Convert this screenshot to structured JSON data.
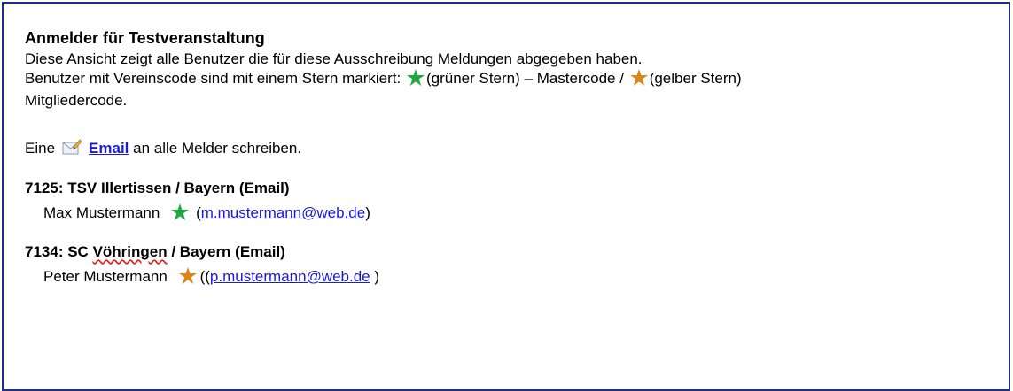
{
  "heading": "Anmelder für Testveranstaltung",
  "intro": {
    "line1": "Diese Ansicht zeigt alle Benutzer die für diese Ausschreibung Meldungen abgegeben haben.",
    "line2_a": "Benutzer mit Vereinscode sind mit einem Stern markiert:",
    "line2_b": "(grüner Stern) – Mastercode /",
    "line2_c": "(gelber Stern)",
    "line3": "Mitgliedercode."
  },
  "email_all": {
    "prefix": "Eine",
    "link": "Email",
    "suffix": "an alle Melder schreiben."
  },
  "clubs": [
    {
      "title": "7125: TSV Illertissen / Bayern (Email)",
      "member_name": "Max Mustermann",
      "open": "(",
      "email": "m.mustermann@web.de",
      "close": ")"
    },
    {
      "title_a": "7134: SC",
      "title_b": "Vöhringen",
      "title_c": "/ Bayern (Email)",
      "member_name": "Peter Mustermann",
      "open": "((",
      "email": "p.mustermann@web.de",
      "close": ")"
    }
  ],
  "colors": {
    "frame": "#1f2f8f",
    "link": "#1a1ad6",
    "star_green": "#22a842",
    "star_orange": "#d9861c"
  },
  "icons": {
    "green_star": "green-star-icon",
    "orange_star": "orange-star-icon",
    "email": "email-edit-icon"
  }
}
